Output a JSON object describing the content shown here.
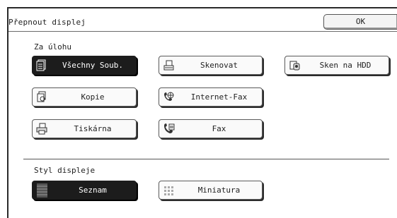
{
  "window": {
    "title": "Přepnout displej",
    "ok_label": "OK"
  },
  "sections": {
    "job": {
      "label": "Za úlohu",
      "buttons": {
        "all_files": {
          "label": "Všechny Soub.",
          "icon": "all-files-icon",
          "selected": true
        },
        "scan": {
          "label": "Skenovat",
          "icon": "scan-icon"
        },
        "scan_hdd": {
          "label": "Sken na HDD",
          "icon": "scan-hdd-icon"
        },
        "copy": {
          "label": "Kopie",
          "icon": "copy-icon"
        },
        "internet_fax": {
          "label": "Internet-Fax",
          "icon": "internet-fax-icon"
        },
        "printer": {
          "label": "Tiskárna",
          "icon": "printer-icon"
        },
        "fax": {
          "label": "Fax",
          "icon": "fax-icon"
        }
      }
    },
    "style": {
      "label": "Styl displeje",
      "buttons": {
        "list": {
          "label": "Seznam",
          "icon": "list-view-icon",
          "selected": true
        },
        "thumbnail": {
          "label": "Miniatura",
          "icon": "thumbnail-view-icon"
        }
      }
    }
  },
  "colors": {
    "selected_bg": "#1c1c1c",
    "button_bg": "#fafafa",
    "frame": "#2a2a2a"
  }
}
